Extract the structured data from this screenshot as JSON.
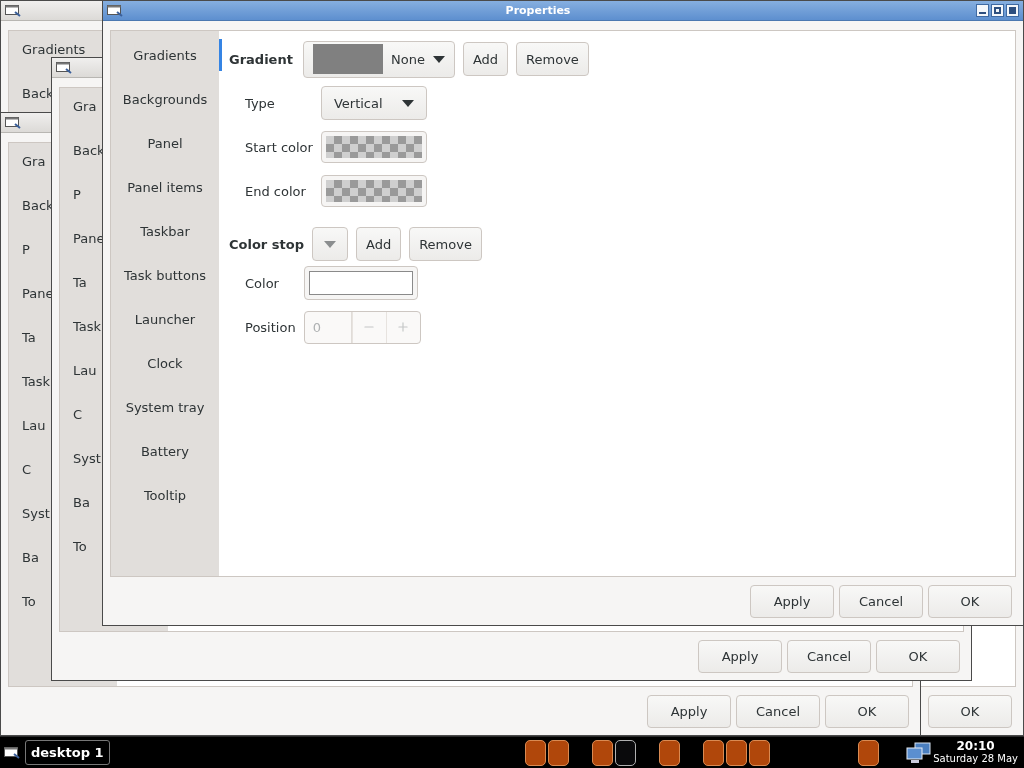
{
  "windows": [
    {
      "kind": "back",
      "sidebar": [
        {
          "label": "Gradients"
        },
        {
          "label": "Back"
        }
      ],
      "buttons": [
        "OK"
      ]
    },
    {
      "kind": "back",
      "sidebar": [
        {
          "label": "Gra"
        },
        {
          "label": "Back"
        },
        {
          "label": "P"
        },
        {
          "label": "Pane"
        },
        {
          "label": "Ta"
        },
        {
          "label": "Task"
        },
        {
          "label": "Lau"
        },
        {
          "label": "C"
        },
        {
          "label": "Syst"
        },
        {
          "label": "Ba"
        },
        {
          "label": "To"
        }
      ],
      "buttons": [
        "Apply",
        "Cancel",
        "OK"
      ]
    },
    {
      "kind": "back",
      "sidebar": [
        {
          "label": "Gra"
        },
        {
          "label": "Back"
        },
        {
          "label": "P"
        },
        {
          "label": "Pane"
        },
        {
          "label": "Ta"
        },
        {
          "label": "Task"
        },
        {
          "label": "Lau"
        },
        {
          "label": "C"
        },
        {
          "label": "Syst"
        },
        {
          "label": "Ba"
        },
        {
          "label": "To"
        }
      ],
      "buttons": [
        "Apply",
        "Cancel",
        "OK"
      ]
    }
  ],
  "main_window": {
    "title": "Properties",
    "sidebar": [
      {
        "label": "Gradients",
        "selected": true
      },
      {
        "label": "Backgrounds",
        "selected": false
      },
      {
        "label": "Panel",
        "selected": false
      },
      {
        "label": "Panel items",
        "selected": false
      },
      {
        "label": "Taskbar",
        "selected": false
      },
      {
        "label": "Task buttons",
        "selected": false
      },
      {
        "label": "Launcher",
        "selected": false
      },
      {
        "label": "Clock",
        "selected": false
      },
      {
        "label": "System tray",
        "selected": false
      },
      {
        "label": "Battery",
        "selected": false
      },
      {
        "label": "Tooltip",
        "selected": false
      }
    ],
    "gradient": {
      "label": "Gradient",
      "value": "None",
      "add": "Add",
      "remove": "Remove",
      "rows": [
        {
          "kind": "combo",
          "label": "Type",
          "value": "Vertical"
        },
        {
          "kind": "checker",
          "label": "Start color"
        },
        {
          "kind": "checker",
          "label": "End color"
        }
      ]
    },
    "color_stop": {
      "label": "Color stop",
      "add": "Add",
      "remove": "Remove",
      "rows": [
        {
          "kind": "color",
          "label": "Color"
        },
        {
          "kind": "spin",
          "label": "Position",
          "value": "0",
          "disabled": true
        }
      ]
    },
    "buttons": [
      "Apply",
      "Cancel",
      "OK"
    ]
  },
  "taskbar": {
    "desktop": "desktop 1",
    "task_groups": [
      [
        {
          "selected": false
        },
        {
          "selected": false
        }
      ],
      [
        {
          "selected": false
        },
        {
          "selected": true
        }
      ],
      [
        {
          "selected": false
        }
      ],
      [
        {
          "selected": false
        },
        {
          "selected": false
        },
        {
          "selected": false
        }
      ],
      [
        {
          "selected": false
        }
      ]
    ],
    "clock": {
      "time": "20:10",
      "date": "Saturday 28 May"
    }
  }
}
